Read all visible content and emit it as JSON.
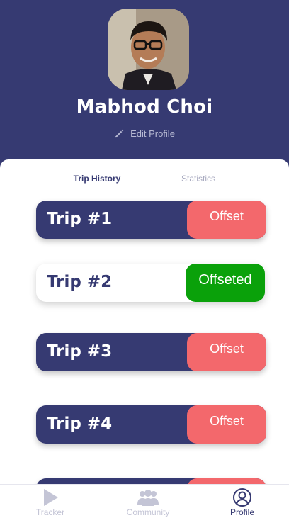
{
  "profile": {
    "name": "Mabhod Choi",
    "edit_label": "Edit Profile"
  },
  "tabs": [
    {
      "label": "Trip History",
      "active": true
    },
    {
      "label": "Statistics",
      "active": false
    }
  ],
  "trips": [
    {
      "label": "Trip #1",
      "status": "Offset",
      "style": "dark"
    },
    {
      "label": "Trip #2",
      "status": "Offseted",
      "style": "light"
    },
    {
      "label": "Trip #3",
      "status": "Offset",
      "style": "dark"
    },
    {
      "label": "Trip #4",
      "status": "Offset",
      "style": "dark"
    }
  ],
  "nav": [
    {
      "label": "Tracker",
      "icon": "play-icon",
      "active": false
    },
    {
      "label": "Community",
      "icon": "users-icon",
      "active": false
    },
    {
      "label": "Profile",
      "icon": "user-circle-icon",
      "active": true
    }
  ],
  "colors": {
    "primary": "#363a72",
    "offset": "#f3686c",
    "offseted": "#0aa10a",
    "inactive": "#c4c5d6"
  }
}
